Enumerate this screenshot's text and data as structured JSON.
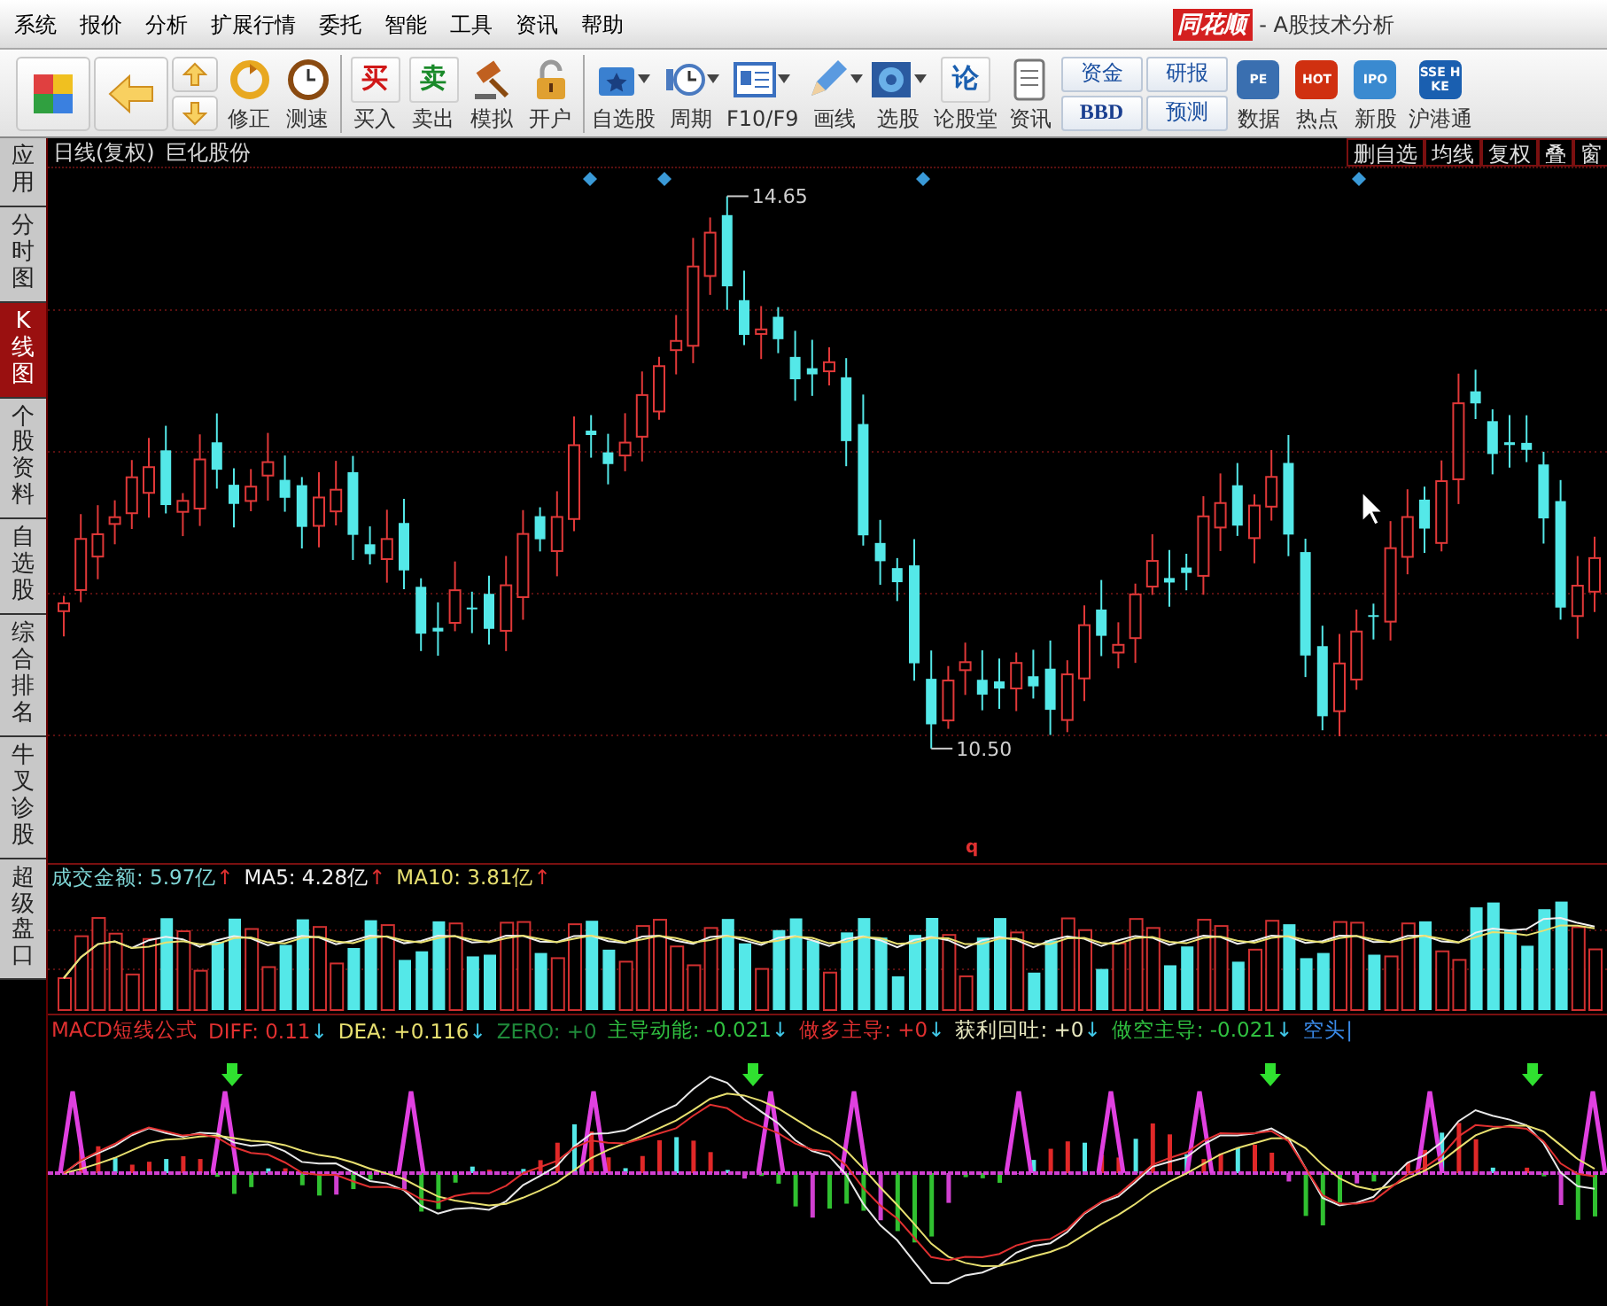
{
  "menu": [
    "系统",
    "报价",
    "分析",
    "扩展行情",
    "委托",
    "智能",
    "工具",
    "资讯",
    "帮助"
  ],
  "title": {
    "logo": "同花顺",
    "text": "- A股技术分析"
  },
  "toolbar": [
    [
      {
        "kind": "grid"
      },
      {
        "kind": "back"
      },
      {
        "kind": "updown"
      },
      {
        "kind": "refresh",
        "label": "修正"
      },
      {
        "kind": "clock",
        "label": "测速"
      }
    ],
    [
      {
        "kind": "glyph",
        "glyph": "买",
        "label": "买入",
        "color": "#d01818"
      },
      {
        "kind": "glyph",
        "glyph": "卖",
        "label": "卖出",
        "color": "#1a8a2a"
      },
      {
        "kind": "gavel",
        "label": "模拟"
      },
      {
        "kind": "lock",
        "label": "开户"
      }
    ],
    [
      {
        "kind": "star-folder",
        "label": "自选股",
        "dropdown": true
      },
      {
        "kind": "cycle",
        "label": "周期",
        "dropdown": true
      },
      {
        "kind": "card",
        "label": "F10/F9",
        "dropdown": true
      },
      {
        "kind": "pencil",
        "label": "画线",
        "dropdown": true
      },
      {
        "kind": "radar",
        "label": "选股",
        "dropdown": true
      },
      {
        "kind": "glyph",
        "glyph": "论",
        "label": "论股堂",
        "color": "#1a5fb0"
      },
      {
        "kind": "doc",
        "label": "资讯"
      },
      {
        "kind": "pair",
        "labels": [
          "资金",
          "BBD"
        ]
      },
      {
        "kind": "pair",
        "labels": [
          "研报",
          "预测"
        ]
      },
      {
        "kind": "badge",
        "glyph": "PE",
        "label": "数据",
        "color": "#3a6fb0"
      },
      {
        "kind": "badge",
        "glyph": "HOT",
        "label": "热点",
        "color": "#d03010"
      },
      {
        "kind": "badge",
        "glyph": "IPO",
        "label": "新股",
        "color": "#3a8ad0"
      },
      {
        "kind": "badge",
        "glyph": "SSE HKE",
        "label": "沪港通",
        "color": "#1a5fb0"
      }
    ]
  ],
  "sidebar": [
    {
      "label": "应用",
      "selected": false
    },
    {
      "label": "分时图",
      "selected": false
    },
    {
      "label": "K线图",
      "selected": true
    },
    {
      "label": "个股资料",
      "selected": false
    },
    {
      "label": "自选股",
      "selected": false
    },
    {
      "label": "综合排名",
      "selected": false
    },
    {
      "label": "牛叉诊股",
      "selected": false
    },
    {
      "label": "超级盘口",
      "selected": false
    }
  ],
  "chart_header": {
    "period": "日线(复权)",
    "stock": "巨化股份",
    "tools": [
      "删自选",
      "均线",
      "复权",
      "叠",
      "窗"
    ]
  },
  "price_chart": {
    "high_label": "14.65",
    "low_label": "10.50",
    "marker": "q"
  },
  "volume": {
    "legend": [
      {
        "label": "成交金额:",
        "value": "5.97亿",
        "arrow": "↑",
        "color": "#80d8d8"
      },
      {
        "label": "MA5:",
        "value": "4.28亿",
        "arrow": "↑",
        "color": "#f0f0f0"
      },
      {
        "label": "MA10:",
        "value": "3.81亿",
        "arrow": "↑",
        "color": "#e8e070"
      }
    ]
  },
  "macd": {
    "legend": [
      {
        "label": "MACD短线公式",
        "color": "#e03030"
      },
      {
        "label": "DIFF:",
        "value": "0.11",
        "arrow": "↓",
        "color": "#e03030"
      },
      {
        "label": "DEA:",
        "value": "+0.116",
        "arrow": "↓",
        "color": "#e8e070"
      },
      {
        "label": "ZERO:",
        "value": "+0",
        "color": "#1f8a3a"
      },
      {
        "label": "主导动能:",
        "value": "-0.021",
        "arrow": "↓",
        "color": "#30c040"
      },
      {
        "label": "做多主导:",
        "value": "+0",
        "arrow": "↓",
        "color": "#e03030"
      },
      {
        "label": "获利回吐:",
        "value": "+0",
        "arrow": "↓",
        "color": "#e8e8c0"
      },
      {
        "label": "做空主导:",
        "value": "-0.021",
        "arrow": "↓",
        "color": "#30c040"
      },
      {
        "label": "空头|",
        "color": "#3a8ae8"
      }
    ]
  }
}
